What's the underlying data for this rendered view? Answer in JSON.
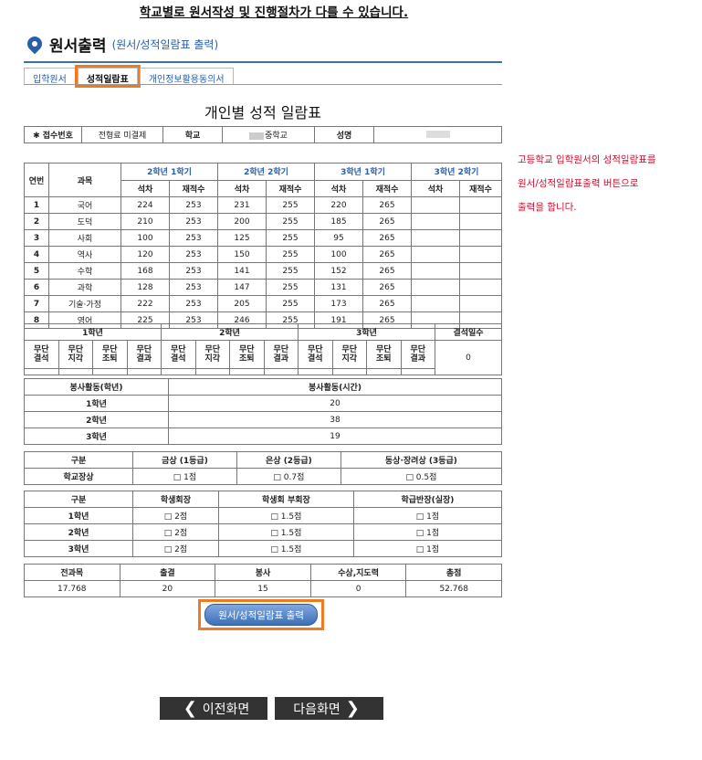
{
  "notice": "학교별로 원서작성 및 진행절차가 다를 수 있습니다.",
  "header": {
    "title": "원서출력",
    "subtitle": "(원서/성적일람표 출력)",
    "icon": "location-pin-icon",
    "accent": "#2a5fa8"
  },
  "tabs": [
    {
      "label": "입학원서"
    },
    {
      "label": "성적일람표"
    },
    {
      "label": "개인정보활용동의서"
    }
  ],
  "sheet_title": "개인별 성적 일람표",
  "info": {
    "receipt_label": "✱ 접수번호",
    "receipt_value": "전형료 미결제",
    "school_label": "학교",
    "school_value": "중학교",
    "name_label": "성명",
    "name_value": ""
  },
  "grades": {
    "row_no_header": "연번",
    "subject_header": "과목",
    "terms": [
      "2학년 1학기",
      "2학년 2학기",
      "3학년 1학기",
      "3학년 2학기"
    ],
    "sub_headers": [
      "석차",
      "재적수"
    ],
    "rows": [
      {
        "no": "1",
        "subject": "국어",
        "cells": [
          "224",
          "253",
          "231",
          "255",
          "220",
          "265",
          "",
          ""
        ]
      },
      {
        "no": "2",
        "subject": "도덕",
        "cells": [
          "210",
          "253",
          "200",
          "255",
          "185",
          "265",
          "",
          ""
        ]
      },
      {
        "no": "3",
        "subject": "사회",
        "cells": [
          "100",
          "253",
          "125",
          "255",
          "95",
          "265",
          "",
          ""
        ]
      },
      {
        "no": "4",
        "subject": "역사",
        "cells": [
          "120",
          "253",
          "150",
          "255",
          "100",
          "265",
          "",
          ""
        ]
      },
      {
        "no": "5",
        "subject": "수학",
        "cells": [
          "168",
          "253",
          "141",
          "255",
          "152",
          "265",
          "",
          ""
        ]
      },
      {
        "no": "6",
        "subject": "과학",
        "cells": [
          "128",
          "253",
          "147",
          "255",
          "131",
          "265",
          "",
          ""
        ]
      },
      {
        "no": "7",
        "subject": "기술·가정",
        "cells": [
          "222",
          "253",
          "205",
          "255",
          "173",
          "265",
          "",
          ""
        ]
      },
      {
        "no": "8",
        "subject": "영어",
        "cells": [
          "225",
          "253",
          "246",
          "255",
          "191",
          "265",
          "",
          ""
        ]
      }
    ]
  },
  "attendance": {
    "years": [
      "1학년",
      "2학년",
      "3학년"
    ],
    "absent_days_label": "결석일수",
    "absent_days_value": "0",
    "items": [
      {
        "l1": "무단",
        "l2": "결석"
      },
      {
        "l1": "무단",
        "l2": "지각"
      },
      {
        "l1": "무단",
        "l2": "조퇴"
      },
      {
        "l1": "무단",
        "l2": "결과"
      }
    ]
  },
  "volunteer": {
    "header_year": "봉사활동(학년)",
    "header_time": "봉사활동(시간)",
    "rows": [
      {
        "year": "1학년",
        "hours": "20"
      },
      {
        "year": "2학년",
        "hours": "38"
      },
      {
        "year": "3학년",
        "hours": "19"
      }
    ]
  },
  "awards": {
    "headers": [
      "구분",
      "금상 (1등급)",
      "은상 (2등급)",
      "동상·장려상 (3등급)"
    ],
    "row": [
      "학교장상",
      "□ 1점",
      "□ 0.7점",
      "□ 0.5점"
    ]
  },
  "council": {
    "headers": [
      "구분",
      "학생회장",
      "학생회 부회장",
      "학급반장(실장)"
    ],
    "rows": [
      [
        "1학년",
        "□ 2점",
        "□ 1.5점",
        "□ 1점"
      ],
      [
        "2학년",
        "□ 2점",
        "□ 1.5점",
        "□ 1점"
      ],
      [
        "3학년",
        "□ 2점",
        "□ 1.5점",
        "□ 1점"
      ]
    ]
  },
  "summary": {
    "headers": [
      "전과목",
      "출결",
      "봉사",
      "수상,지도력",
      "총점"
    ],
    "values": [
      "17.768",
      "20",
      "15",
      "0",
      "52.768"
    ]
  },
  "side_note": {
    "lines": [
      "고등학교 입학원서의 성적일람표를",
      "원서/성적일람표출력 버튼으로",
      "출력을 합니다."
    ],
    "color": "#c8102e"
  },
  "print_button": "원서/성적일람표 출력",
  "nav": {
    "prev": "이전화면",
    "next": "다음화면",
    "prev_icon": "chevron-left-icon",
    "next_icon": "chevron-right-icon"
  },
  "highlight_color": "#ef7a22"
}
